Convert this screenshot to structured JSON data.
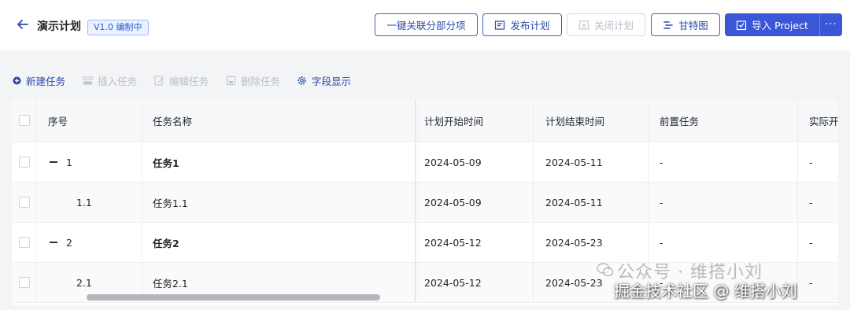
{
  "header": {
    "title": "演示计划",
    "version_badge": "V1.0 编制中",
    "buttons": {
      "link_sub": "一键关联分部分项",
      "publish": "发布计划",
      "close": "关闭计划",
      "gantt": "甘特图",
      "import": "导入 Project",
      "more": "···"
    }
  },
  "toolbar": {
    "new_task": "新建任务",
    "insert_task": "插入任务",
    "edit_task": "编辑任务",
    "delete_task": "删除任务",
    "field_display": "字段显示"
  },
  "table": {
    "columns": [
      "序号",
      "任务名称",
      "计划开始时间",
      "计划结束时间",
      "前置任务",
      "实际开"
    ],
    "rows": [
      {
        "seq": "1",
        "name": "任务1",
        "start": "2024-05-09",
        "end": "2024-05-11",
        "pre": "-",
        "actual": "-"
      },
      {
        "seq": "1.1",
        "name": "任务1.1",
        "start": "2024-05-09",
        "end": "2024-05-11",
        "pre": "-",
        "actual": "-"
      },
      {
        "seq": "2",
        "name": "任务2",
        "start": "2024-05-12",
        "end": "2024-05-23",
        "pre": "-",
        "actual": "-"
      },
      {
        "seq": "2.1",
        "name": "任务2.1",
        "start": "2024-05-12",
        "end": "2024-05-23",
        "pre": "-",
        "actual": "-"
      }
    ]
  },
  "watermark": {
    "line1": "公众号 · 维搭小刘",
    "line2": "掘金技术社区 @ 维搭小刘"
  },
  "colors": {
    "accent": "#3b56d6",
    "link": "#2c4aa8",
    "disabled": "#b9bec7"
  }
}
